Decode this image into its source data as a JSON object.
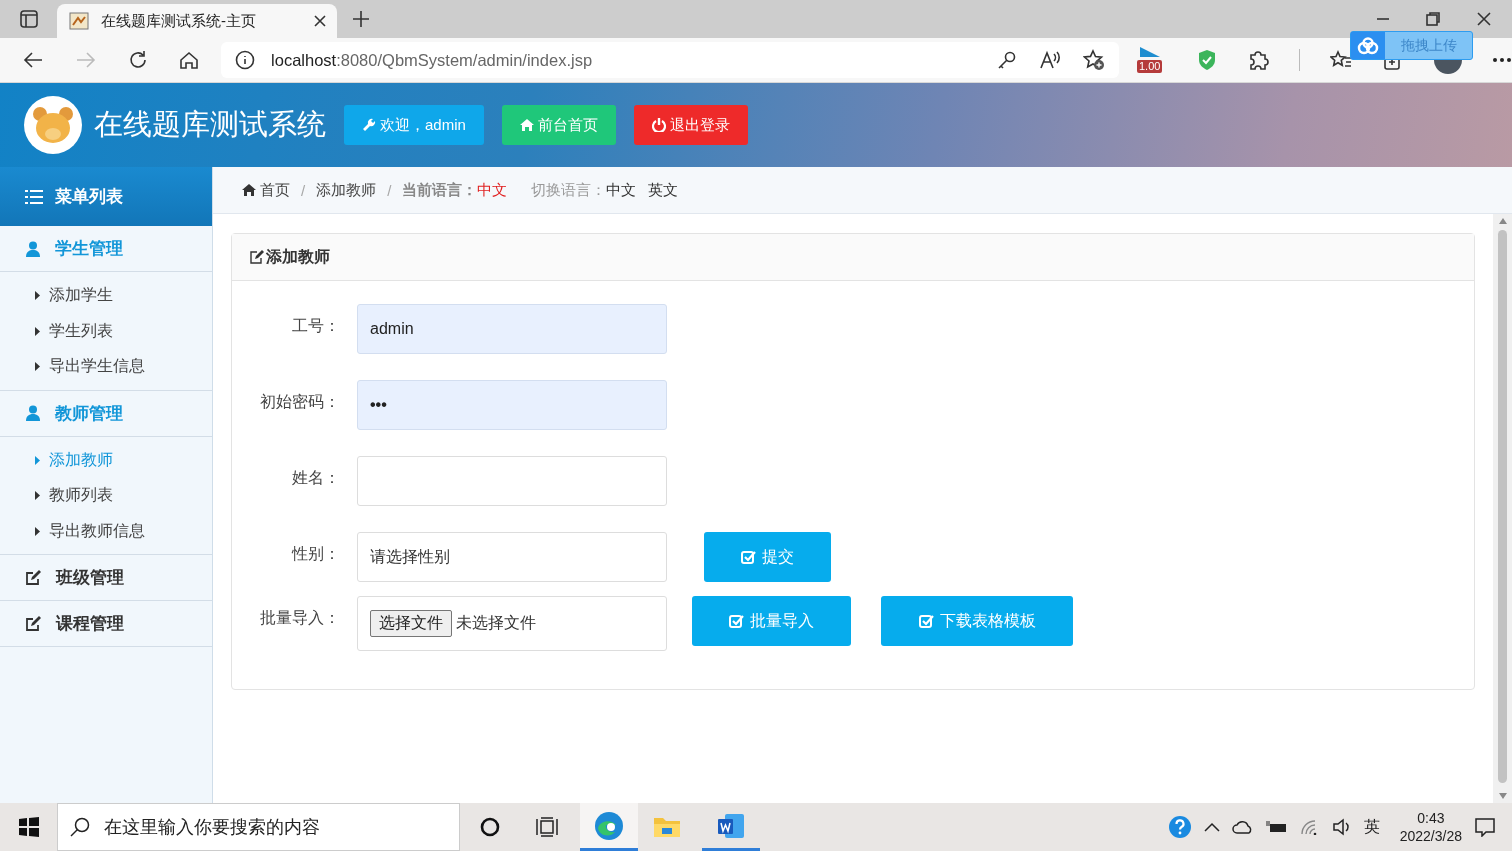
{
  "browser": {
    "tab": {
      "title": "在线题库测试系统-主页"
    },
    "address": {
      "host": "localhost",
      "path": ":8080/QbmSystem/admin/index.jsp"
    },
    "speed_badge": "1.00",
    "upload_widget": "拖拽上传"
  },
  "header": {
    "title": "在线题库测试系统",
    "buttons": [
      {
        "kind": "welcome",
        "label": "欢迎，admin"
      },
      {
        "kind": "home",
        "label": "前台首页"
      },
      {
        "kind": "logout",
        "label": "退出登录"
      }
    ]
  },
  "sidebar": {
    "title": "菜单列表",
    "groups": [
      {
        "label": "学生管理",
        "kind": "user",
        "expanded": true,
        "items": [
          {
            "label": "添加学生",
            "selected": false
          },
          {
            "label": "学生列表",
            "selected": false
          },
          {
            "label": "导出学生信息",
            "selected": false
          }
        ]
      },
      {
        "label": "教师管理",
        "kind": "user",
        "expanded": true,
        "items": [
          {
            "label": "添加教师",
            "selected": true
          },
          {
            "label": "教师列表",
            "selected": false
          },
          {
            "label": "导出教师信息",
            "selected": false
          }
        ]
      },
      {
        "label": "班级管理",
        "kind": "edit",
        "expanded": false
      },
      {
        "label": "课程管理",
        "kind": "edit",
        "expanded": false
      }
    ]
  },
  "breadcrumb": {
    "items": [
      "首页",
      "添加教师"
    ],
    "separators": [
      "/",
      "/"
    ],
    "current_language_label": "当前语言：",
    "current_language": "中文",
    "switch_label": "切换语言：",
    "languages": [
      "中文",
      "英文"
    ]
  },
  "panel": {
    "title": "添加教师",
    "fields": [
      {
        "label": "工号：",
        "kind": "text",
        "value": "admin",
        "autofilled": true
      },
      {
        "label": "初始密码：",
        "kind": "password",
        "value": "•••",
        "autofilled": true
      },
      {
        "label": "姓名：",
        "kind": "text",
        "autofilled": false
      },
      {
        "label": "性别：",
        "kind": "select",
        "value": "请选择性别",
        "autofilled": false,
        "buttons": [
          "提交"
        ]
      },
      {
        "label": "批量导入：",
        "kind": "file",
        "file_button": "选择文件",
        "file_status": "未选择文件",
        "buttons": [
          "批量导入",
          "下载表格模板"
        ]
      }
    ]
  },
  "taskbar": {
    "search": {
      "placeholder": "在这里输入你要搜索的内容"
    },
    "apps": [
      {
        "kind": "edge",
        "active": true,
        "running": true
      },
      {
        "kind": "explorer",
        "active": false,
        "running": false
      },
      {
        "kind": "word",
        "active": false,
        "running": true
      }
    ],
    "tray": {
      "ime": "英",
      "time": "0:43",
      "date": "2022/3/28"
    }
  }
}
